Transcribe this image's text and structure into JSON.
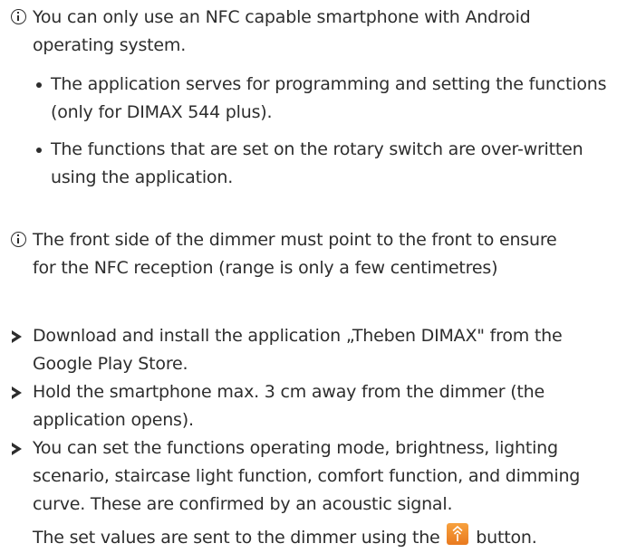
{
  "notes": {
    "first": {
      "icon": "info-icon",
      "text": "You can only use an NFC capable smartphone with Android operating system."
    },
    "bullets": [
      "The application serves for programming and setting the functions (only for DIMAX 544 plus).",
      "The functions that are set on the rotary switch are over-written using the application."
    ],
    "second": {
      "icon": "info-icon",
      "text": "The front side of the dimmer must point to the front to ensure for the NFC reception (range is only a few centimetres)"
    }
  },
  "steps": [
    "Download and install the application „Theben DIMAX\" from the Google Play Store.",
    "Hold the smartphone max. 3 cm away from the dimmer (the application opens).",
    "You can set the functions operating mode, brightness, lighting scenario, staircase light function, comfort function, and dimming curve. These are confirmed by an acoustic signal."
  ],
  "send_line": {
    "before": "The set values are sent to the dimmer using the",
    "icon": "send-icon",
    "after": "button."
  },
  "colors": {
    "text": "#2d2d2d",
    "send_icon": "#ef8a2a"
  }
}
